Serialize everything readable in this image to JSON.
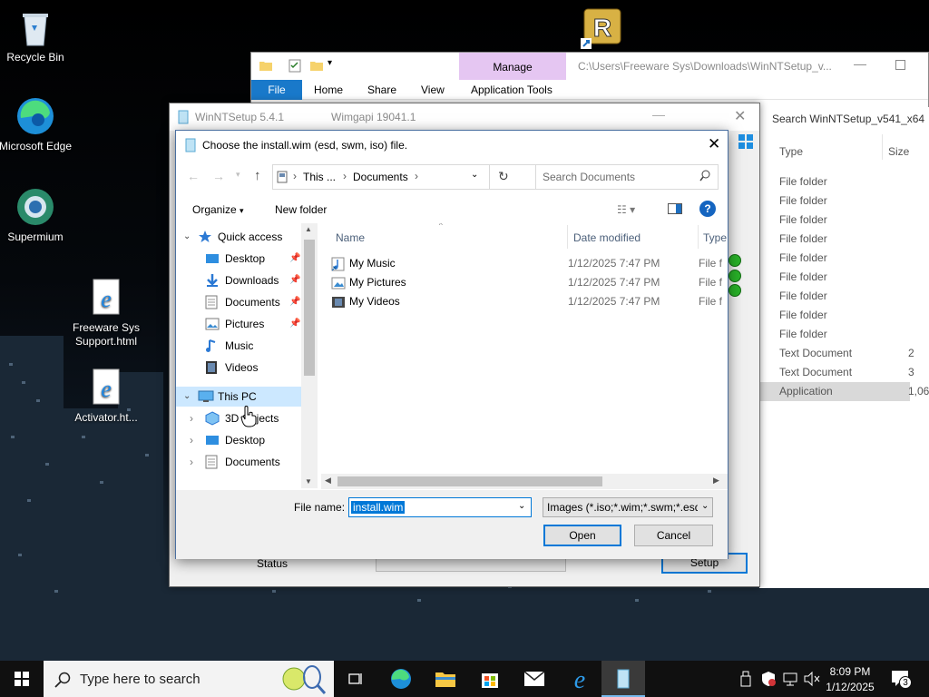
{
  "desktop": {
    "icons": [
      {
        "label": "Recycle Bin"
      },
      {
        "label": "Microsoft Edge"
      },
      {
        "label": "Supermium"
      },
      {
        "label": "Freeware Sys Support.html"
      },
      {
        "label": "Activator.ht..."
      }
    ],
    "rufus_label": "R"
  },
  "explorer": {
    "path": "C:\\Users\\Freeware Sys\\Downloads\\WinNTSetup_v...",
    "manage_label": "Manage",
    "tabs": [
      "File",
      "Home",
      "Share",
      "View",
      "Application Tools"
    ],
    "search_text": "Search WinNTSetup_v541_x64",
    "columns": {
      "type": "Type",
      "size": "Size"
    },
    "rows": [
      {
        "type": "File folder",
        "size": ""
      },
      {
        "type": "File folder",
        "size": ""
      },
      {
        "type": "File folder",
        "size": ""
      },
      {
        "type": "File folder",
        "size": ""
      },
      {
        "type": "File folder",
        "size": ""
      },
      {
        "type": "File folder",
        "size": ""
      },
      {
        "type": "File folder",
        "size": ""
      },
      {
        "type": "File folder",
        "size": ""
      },
      {
        "type": "File folder",
        "size": ""
      },
      {
        "type": "Text Document",
        "size": "2"
      },
      {
        "type": "Text Document",
        "size": "3"
      },
      {
        "type": "Application",
        "size": "1,06"
      }
    ]
  },
  "winntsetup": {
    "title": "WinNTSetup 5.4.1",
    "wimgapi": "Wimgapi 19041.1",
    "status_label": "Status",
    "setup_label": "Setup"
  },
  "dialog": {
    "title": "Choose the install.wim (esd, swm, iso) file.",
    "breadcrumb": [
      "This ...",
      "Documents"
    ],
    "search_placeholder": "Search Documents",
    "organize_label": "Organize",
    "new_folder_label": "New folder",
    "tree": [
      {
        "label": "Quick access",
        "level": 0,
        "expanded": true,
        "pinned": false,
        "icon": "star-icon"
      },
      {
        "label": "Desktop",
        "level": 1,
        "pinned": true,
        "icon": "desktop-folder-icon"
      },
      {
        "label": "Downloads",
        "level": 1,
        "pinned": true,
        "icon": "download-folder-icon"
      },
      {
        "label": "Documents",
        "level": 1,
        "pinned": true,
        "icon": "documents-folder-icon"
      },
      {
        "label": "Pictures",
        "level": 1,
        "pinned": true,
        "icon": "pictures-folder-icon"
      },
      {
        "label": "Music",
        "level": 1,
        "pinned": false,
        "icon": "music-folder-icon"
      },
      {
        "label": "Videos",
        "level": 1,
        "pinned": false,
        "icon": "videos-folder-icon"
      },
      {
        "label": "This PC",
        "level": 0,
        "expanded": true,
        "pinned": false,
        "icon": "computer-icon"
      },
      {
        "label": "3D Objects",
        "level": 1,
        "pinned": false,
        "icon": "3d-objects-folder-icon"
      },
      {
        "label": "Desktop",
        "level": 1,
        "pinned": false,
        "icon": "desktop-folder-icon"
      },
      {
        "label": "Documents",
        "level": 1,
        "pinned": false,
        "icon": "documents-folder-icon"
      }
    ],
    "columns": {
      "name": "Name",
      "date": "Date modified",
      "type": "Type"
    },
    "files": [
      {
        "name": "My Music",
        "date": "1/12/2025 7:47 PM",
        "type": "File f",
        "icon": "music-shortcut-icon"
      },
      {
        "name": "My Pictures",
        "date": "1/12/2025 7:47 PM",
        "type": "File f",
        "icon": "pictures-shortcut-icon"
      },
      {
        "name": "My Videos",
        "date": "1/12/2025 7:47 PM",
        "type": "File f",
        "icon": "videos-shortcut-icon"
      }
    ],
    "file_name_label": "File name:",
    "file_name_value": "install.wim",
    "filter_value": "Images (*.iso;*.wim;*.swm;*.esd",
    "open_label": "Open",
    "cancel_label": "Cancel"
  },
  "taskbar": {
    "search_placeholder": "Type here to search",
    "time": "8:09 PM",
    "date": "1/12/2025",
    "notification_count": "3"
  },
  "colors": {
    "accent": "#0078d7",
    "selection": "#cce8ff",
    "manage_tab": "#e5c6f2"
  }
}
